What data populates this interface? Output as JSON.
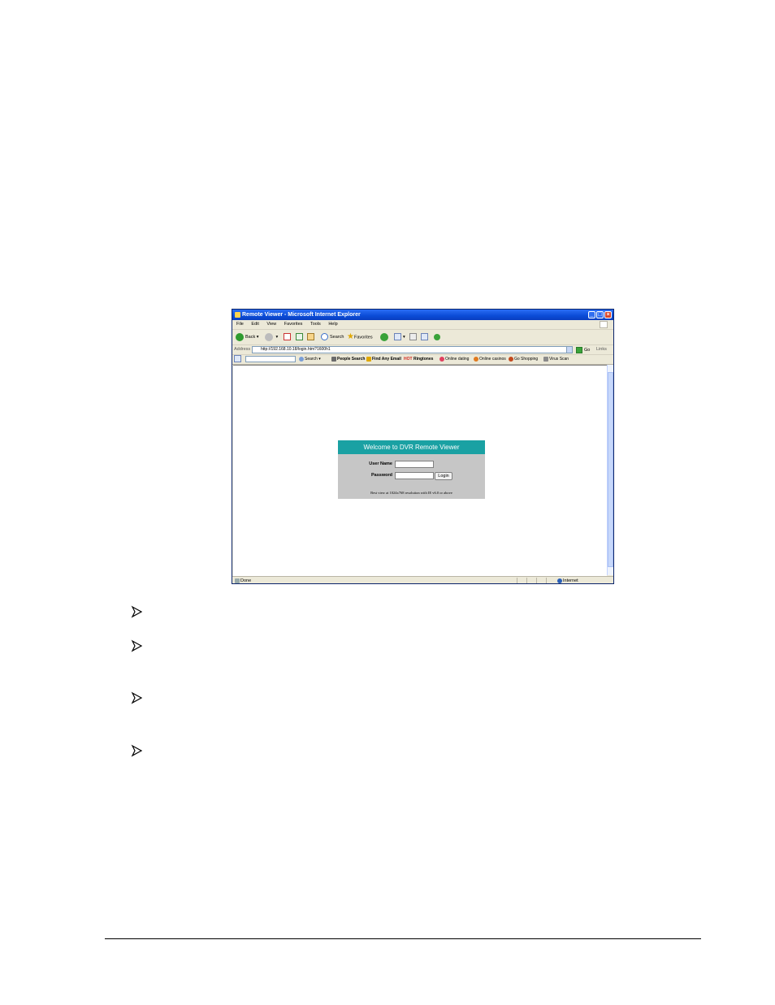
{
  "browser": {
    "title": "Remote Viewer - Microsoft Internet Explorer",
    "menu": [
      "File",
      "Edit",
      "View",
      "Favorites",
      "Tools",
      "Help"
    ],
    "toolbar": {
      "back": "Back",
      "search": "Search",
      "favorites": "Favorites"
    },
    "address": {
      "label": "Address",
      "url": "http://192.168.10.18/login.htm?1600h1",
      "go": "Go",
      "links": "Links"
    },
    "linkbar": {
      "search": "Search",
      "items": [
        "People Search",
        "Find Any Email",
        "HOT",
        "Ringtones",
        "Online dating",
        "Online casinos",
        "Go Shopping",
        "Virus Scan"
      ]
    },
    "status": {
      "left": "Done",
      "zone": "Internet"
    }
  },
  "login": {
    "title": "Welcome to DVR Remote Viewer",
    "username_label": "User Name",
    "password_label": "Password",
    "button": "Login",
    "note": "Best view at 1024x768 resolution with IE v6.0 or above"
  }
}
